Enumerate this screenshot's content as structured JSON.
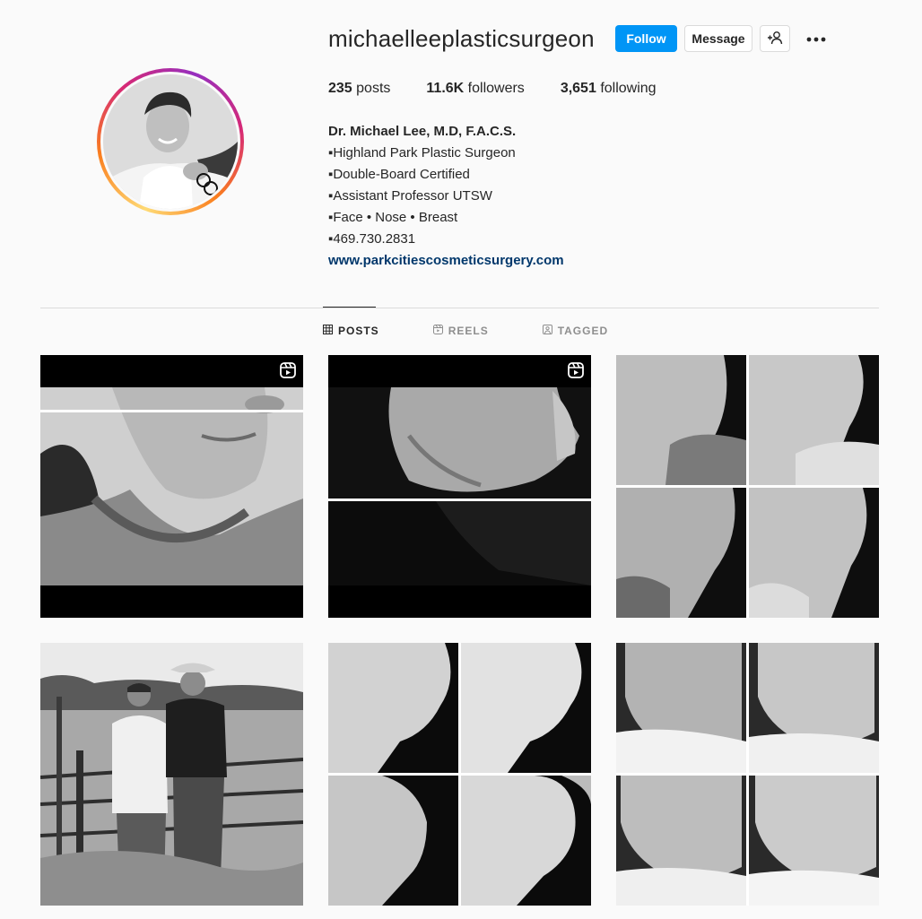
{
  "profile": {
    "username": "michaelleeplasticsurgeon",
    "follow_label": "Follow",
    "message_label": "Message",
    "add_user_icon": "add-user-icon",
    "more_icon": "more-options-icon"
  },
  "stats": {
    "posts_count": "235",
    "posts_label": "posts",
    "followers_count": "11.6K",
    "followers_label": "followers",
    "following_count": "3,651",
    "following_label": "following"
  },
  "bio": {
    "name": "Dr. Michael Lee, M.D, F.A.C.S.",
    "lines": [
      "▪Highland Park Plastic Surgeon",
      "▪Double-Board Certified",
      "▪Assistant Professor UTSW",
      "▪Face • Nose • Breast",
      "▪469.730.2831"
    ],
    "website": "www.parkcitiescosmeticsurgery.com"
  },
  "tabs": [
    {
      "label": "POSTS",
      "icon": "grid-icon",
      "active": true
    },
    {
      "label": "REELS",
      "icon": "reels-icon",
      "active": false
    },
    {
      "label": "TAGGED",
      "icon": "tagged-icon",
      "active": false
    }
  ],
  "posts": [
    {
      "kind": "reel",
      "subject": "woman neck profile black and white"
    },
    {
      "kind": "reel",
      "subject": "side profile jawline black and white"
    },
    {
      "kind": "photo",
      "subject": "before and after facelift four panel"
    },
    {
      "kind": "photo",
      "subject": "two men standing by ranch gate"
    },
    {
      "kind": "photo",
      "subject": "before and after jawline four panel"
    },
    {
      "kind": "photo",
      "subject": "before and after face four panel"
    }
  ],
  "colors": {
    "accent": "#0095f6",
    "link": "#00376b",
    "background": "#fafafa",
    "text": "#262626",
    "muted": "#8e8e8e"
  }
}
